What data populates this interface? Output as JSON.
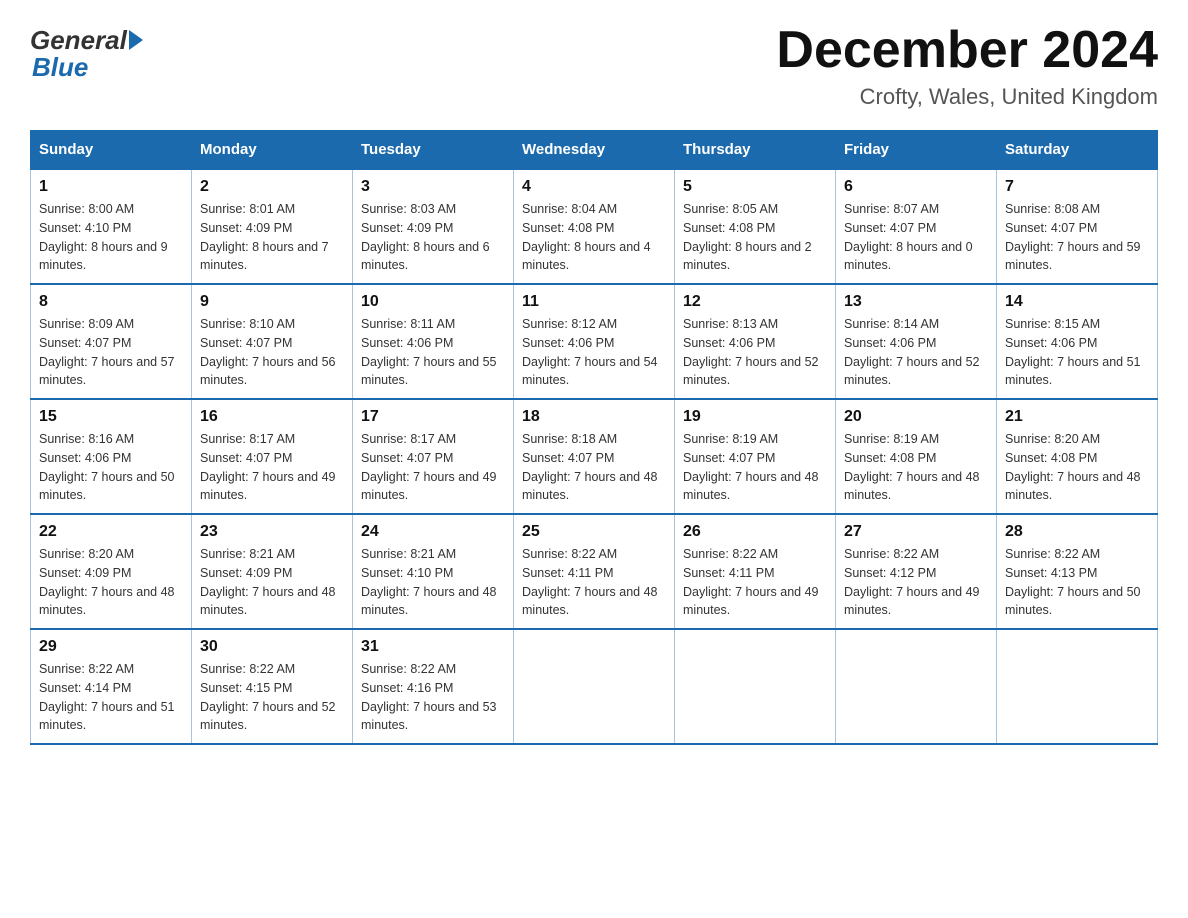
{
  "logo": {
    "general": "General",
    "blue": "Blue"
  },
  "title": "December 2024",
  "subtitle": "Crofty, Wales, United Kingdom",
  "days_of_week": [
    "Sunday",
    "Monday",
    "Tuesday",
    "Wednesday",
    "Thursday",
    "Friday",
    "Saturday"
  ],
  "weeks": [
    [
      {
        "day": "1",
        "sunrise": "8:00 AM",
        "sunset": "4:10 PM",
        "daylight": "8 hours and 9 minutes."
      },
      {
        "day": "2",
        "sunrise": "8:01 AM",
        "sunset": "4:09 PM",
        "daylight": "8 hours and 7 minutes."
      },
      {
        "day": "3",
        "sunrise": "8:03 AM",
        "sunset": "4:09 PM",
        "daylight": "8 hours and 6 minutes."
      },
      {
        "day": "4",
        "sunrise": "8:04 AM",
        "sunset": "4:08 PM",
        "daylight": "8 hours and 4 minutes."
      },
      {
        "day": "5",
        "sunrise": "8:05 AM",
        "sunset": "4:08 PM",
        "daylight": "8 hours and 2 minutes."
      },
      {
        "day": "6",
        "sunrise": "8:07 AM",
        "sunset": "4:07 PM",
        "daylight": "8 hours and 0 minutes."
      },
      {
        "day": "7",
        "sunrise": "8:08 AM",
        "sunset": "4:07 PM",
        "daylight": "7 hours and 59 minutes."
      }
    ],
    [
      {
        "day": "8",
        "sunrise": "8:09 AM",
        "sunset": "4:07 PM",
        "daylight": "7 hours and 57 minutes."
      },
      {
        "day": "9",
        "sunrise": "8:10 AM",
        "sunset": "4:07 PM",
        "daylight": "7 hours and 56 minutes."
      },
      {
        "day": "10",
        "sunrise": "8:11 AM",
        "sunset": "4:06 PM",
        "daylight": "7 hours and 55 minutes."
      },
      {
        "day": "11",
        "sunrise": "8:12 AM",
        "sunset": "4:06 PM",
        "daylight": "7 hours and 54 minutes."
      },
      {
        "day": "12",
        "sunrise": "8:13 AM",
        "sunset": "4:06 PM",
        "daylight": "7 hours and 52 minutes."
      },
      {
        "day": "13",
        "sunrise": "8:14 AM",
        "sunset": "4:06 PM",
        "daylight": "7 hours and 52 minutes."
      },
      {
        "day": "14",
        "sunrise": "8:15 AM",
        "sunset": "4:06 PM",
        "daylight": "7 hours and 51 minutes."
      }
    ],
    [
      {
        "day": "15",
        "sunrise": "8:16 AM",
        "sunset": "4:06 PM",
        "daylight": "7 hours and 50 minutes."
      },
      {
        "day": "16",
        "sunrise": "8:17 AM",
        "sunset": "4:07 PM",
        "daylight": "7 hours and 49 minutes."
      },
      {
        "day": "17",
        "sunrise": "8:17 AM",
        "sunset": "4:07 PM",
        "daylight": "7 hours and 49 minutes."
      },
      {
        "day": "18",
        "sunrise": "8:18 AM",
        "sunset": "4:07 PM",
        "daylight": "7 hours and 48 minutes."
      },
      {
        "day": "19",
        "sunrise": "8:19 AM",
        "sunset": "4:07 PM",
        "daylight": "7 hours and 48 minutes."
      },
      {
        "day": "20",
        "sunrise": "8:19 AM",
        "sunset": "4:08 PM",
        "daylight": "7 hours and 48 minutes."
      },
      {
        "day": "21",
        "sunrise": "8:20 AM",
        "sunset": "4:08 PM",
        "daylight": "7 hours and 48 minutes."
      }
    ],
    [
      {
        "day": "22",
        "sunrise": "8:20 AM",
        "sunset": "4:09 PM",
        "daylight": "7 hours and 48 minutes."
      },
      {
        "day": "23",
        "sunrise": "8:21 AM",
        "sunset": "4:09 PM",
        "daylight": "7 hours and 48 minutes."
      },
      {
        "day": "24",
        "sunrise": "8:21 AM",
        "sunset": "4:10 PM",
        "daylight": "7 hours and 48 minutes."
      },
      {
        "day": "25",
        "sunrise": "8:22 AM",
        "sunset": "4:11 PM",
        "daylight": "7 hours and 48 minutes."
      },
      {
        "day": "26",
        "sunrise": "8:22 AM",
        "sunset": "4:11 PM",
        "daylight": "7 hours and 49 minutes."
      },
      {
        "day": "27",
        "sunrise": "8:22 AM",
        "sunset": "4:12 PM",
        "daylight": "7 hours and 49 minutes."
      },
      {
        "day": "28",
        "sunrise": "8:22 AM",
        "sunset": "4:13 PM",
        "daylight": "7 hours and 50 minutes."
      }
    ],
    [
      {
        "day": "29",
        "sunrise": "8:22 AM",
        "sunset": "4:14 PM",
        "daylight": "7 hours and 51 minutes."
      },
      {
        "day": "30",
        "sunrise": "8:22 AM",
        "sunset": "4:15 PM",
        "daylight": "7 hours and 52 minutes."
      },
      {
        "day": "31",
        "sunrise": "8:22 AM",
        "sunset": "4:16 PM",
        "daylight": "7 hours and 53 minutes."
      },
      null,
      null,
      null,
      null
    ]
  ],
  "labels": {
    "sunrise": "Sunrise: ",
    "sunset": "Sunset: ",
    "daylight": "Daylight: "
  }
}
